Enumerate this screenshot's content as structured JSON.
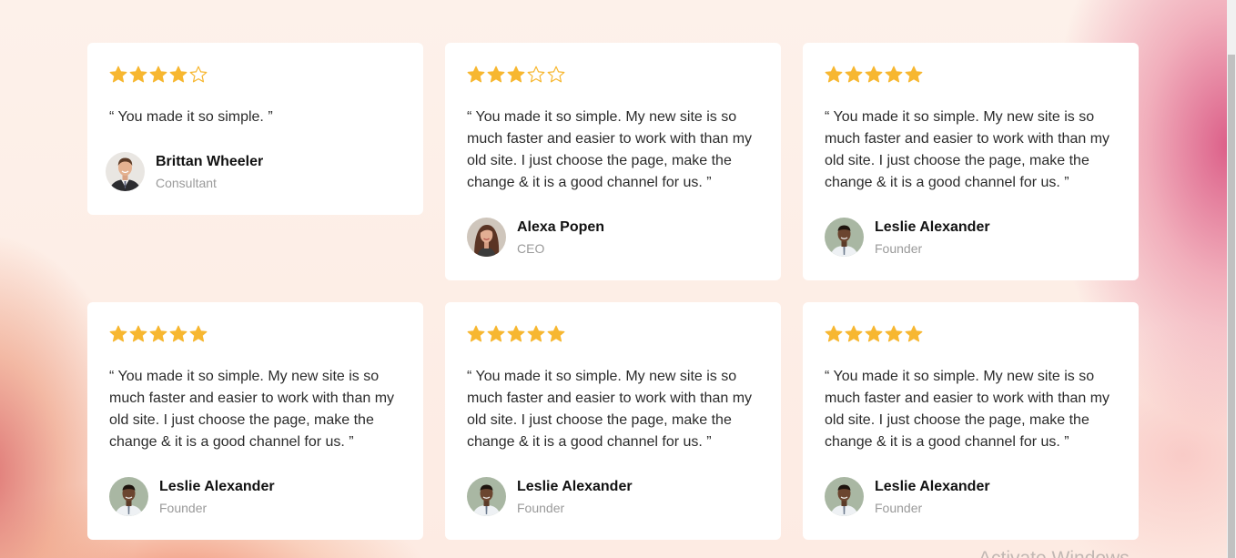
{
  "colors": {
    "star_filled": "#f7b731",
    "star_outline": "#f7b731",
    "card_bg": "#ffffff",
    "name": "#111111",
    "role": "#9a9a9a"
  },
  "testimonials": [
    {
      "rating": 4,
      "max_rating": 5,
      "quote": "“ You made it so simple. ”",
      "name": "Brittan Wheeler",
      "role": "Consultant",
      "avatar_icon": "man-suit-avatar"
    },
    {
      "rating": 3,
      "max_rating": 5,
      "quote": "“ You made it so simple. My new site is so much faster and easier to work with than my old site. I just choose the page, make the change & it is a good channel for us. ”",
      "name": "Alexa Popen",
      "role": "CEO",
      "avatar_icon": "woman-avatar"
    },
    {
      "rating": 5,
      "max_rating": 5,
      "quote": "“ You made it so simple. My new site is so much faster and easier to work with than my old site. I just choose the page, make the change & it is a good channel for us. ”",
      "name": "Leslie Alexander",
      "role": "Founder",
      "avatar_icon": "man-avatar"
    },
    {
      "rating": 5,
      "max_rating": 5,
      "quote": "“ You made it so simple. My new site is so much faster and easier to work with than my old site. I just choose the page, make the change & it is a good channel for us. ”",
      "name": "Leslie Alexander",
      "role": "Founder",
      "avatar_icon": "man-avatar"
    },
    {
      "rating": 5,
      "max_rating": 5,
      "quote": "“ You made it so simple. My new site is so much faster and easier to work with than my old site. I just choose the page, make the change & it is a good channel for us. ”",
      "name": "Leslie Alexander",
      "role": "Founder",
      "avatar_icon": "man-avatar"
    },
    {
      "rating": 5,
      "max_rating": 5,
      "quote": "“ You made it so simple. My new site is so much faster and easier to work with than my old site. I just choose the page, make the change & it is a good channel for us. ”",
      "name": "Leslie Alexander",
      "role": "Founder",
      "avatar_icon": "man-avatar"
    }
  ],
  "watermark": "Activate Windows"
}
